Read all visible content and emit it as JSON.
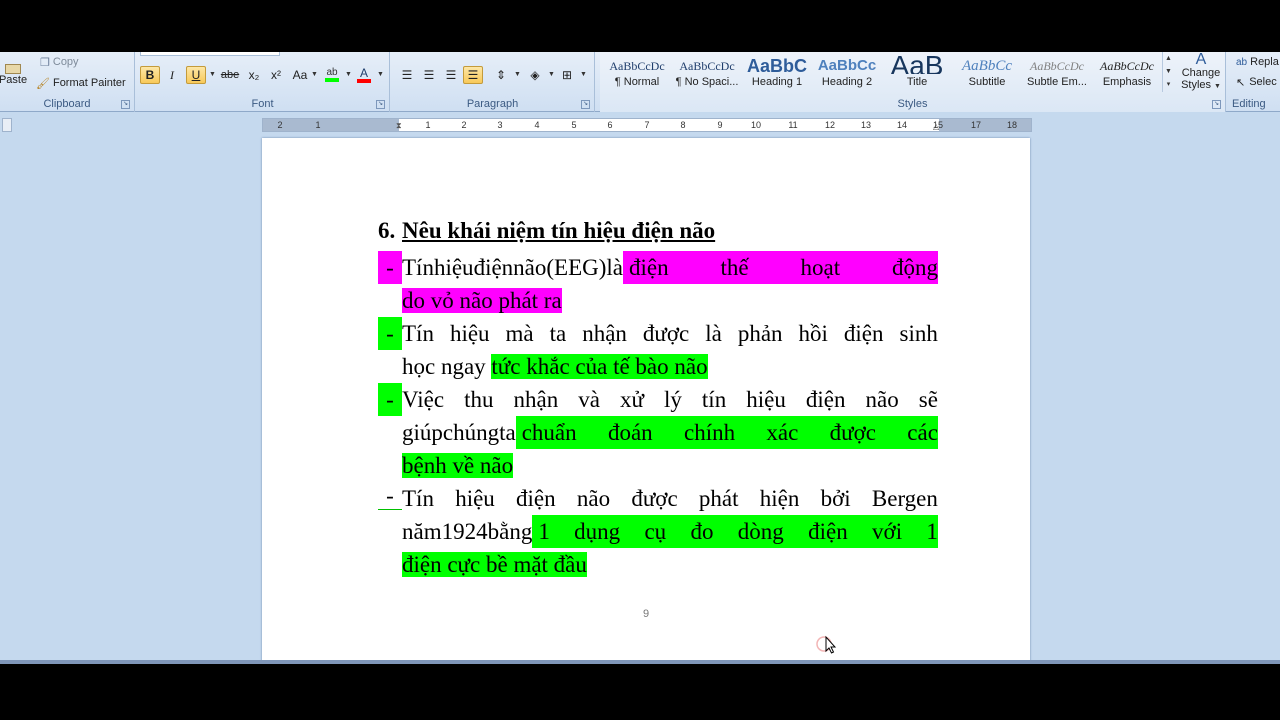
{
  "ribbon": {
    "clipboard": {
      "paste_label": "Paste",
      "copy_label": "Copy",
      "format_painter_label": "Format Painter",
      "group_label": "Clipboard"
    },
    "font": {
      "group_label": "Font",
      "bold": "B",
      "italic": "I",
      "underline": "U",
      "strikethrough": "abe",
      "subscript": "x₂",
      "superscript": "x²",
      "change_case": "Aa",
      "highlight_color": "#00ff00",
      "font_color": "#ff0000"
    },
    "paragraph": {
      "group_label": "Paragraph"
    },
    "styles": {
      "group_label": "Styles",
      "items": [
        {
          "preview": "AaBbCcDc",
          "name": "¶ Normal"
        },
        {
          "preview": "AaBbCcDc",
          "name": "¶ No Spaci..."
        },
        {
          "preview": "AaBbC",
          "name": "Heading 1"
        },
        {
          "preview": "AaBbCc",
          "name": "Heading 2"
        },
        {
          "preview": "AaB",
          "name": "Title"
        },
        {
          "preview": "AaBbCc",
          "name": "Subtitle"
        },
        {
          "preview": "AaBbCcDc",
          "name": "Subtle Em..."
        },
        {
          "preview": "AaBbCcDc",
          "name": "Emphasis"
        }
      ],
      "change_styles_line1": "Change",
      "change_styles_line2": "Styles"
    },
    "editing": {
      "group_label": "Editing",
      "replace_label": "Repla",
      "select_label": "Selec"
    }
  },
  "ruler": {
    "ticks": [
      "2",
      "1",
      "1",
      "2",
      "3",
      "4",
      "5",
      "6",
      "7",
      "8",
      "9",
      "10",
      "11",
      "12",
      "13",
      "14",
      "15",
      "17",
      "18"
    ]
  },
  "document": {
    "title_number": "6.",
    "title_text": "Nêu khái niệm tín hiệu điện não",
    "bullet_char": "-",
    "bullets": [
      [
        [
          {
            "t": "Tín hiệu điện não (EEG) là",
            "h": ""
          },
          {
            "t": "điện thế hoạt động",
            "h": "m"
          }
        ],
        [
          {
            "t": "do vỏ não phát ra",
            "h": "m"
          }
        ]
      ],
      [
        [
          {
            "t": "Tín hiệu mà ta nhận được là phản hồi điện sinh",
            "h": ""
          }
        ],
        [
          {
            "t": "học ngay ",
            "h": ""
          },
          {
            "t": "tức khắc của tế bào não",
            "h": "g"
          }
        ]
      ],
      [
        [
          {
            "t": "Việc thu nhận và xử lý tín hiệu điện não sẽ",
            "h": ""
          }
        ],
        [
          {
            "t": "giúp chúng ta",
            "h": ""
          },
          {
            "t": "chuẩn đoán chính xác được các",
            "h": "g"
          }
        ],
        [
          {
            "t": "bệnh về não",
            "h": "g"
          }
        ]
      ],
      [
        [
          {
            "t": "Tín hiệu điện não được phát hiện bởi Bergen",
            "h": ""
          }
        ],
        [
          {
            "t": "năm 1924 bằng",
            "h": ""
          },
          {
            "t": "1 dụng cụ đo dòng điện với 1",
            "h": "g"
          }
        ],
        [
          {
            "t": "điện cực bề mặt  đầu",
            "h": "g"
          }
        ]
      ]
    ],
    "bullet_highlight": [
      "m",
      "g",
      "g",
      ""
    ],
    "page_number": "9",
    "colors": {
      "magenta_highlight": "#ff00ff",
      "green_highlight": "#00ff00"
    }
  }
}
